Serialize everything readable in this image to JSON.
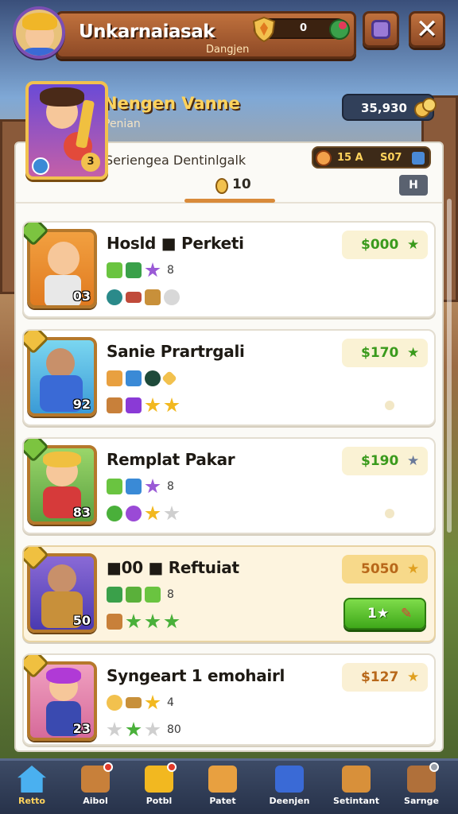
{
  "header": {
    "title": "Unkarnaiasak",
    "subtitle": "Dangjen",
    "resource_value": "0"
  },
  "hero": {
    "name": "Nengen Vanne",
    "role": "Penian",
    "coins": "35,930",
    "portrait_level": "3"
  },
  "panel": {
    "subtitle": "Seriengea Dentinlgalk",
    "stat_a": "15 A",
    "stat_b": "S07",
    "tab_count": "10",
    "tab_button": "H"
  },
  "cards": [
    {
      "name": "Hosld ■ Perketi",
      "price": "$000",
      "level": "03",
      "row1_text": "8",
      "highlighted": false
    },
    {
      "name": "Sanie Prartrgali",
      "price": "$170",
      "level": "92",
      "row1_text": "",
      "highlighted": false
    },
    {
      "name": "Remplat Pakar",
      "price": "$190",
      "level": "83",
      "row1_text": "8",
      "highlighted": false
    },
    {
      "name": "■00 ■ Reftuiat",
      "price": "5050",
      "level": "50",
      "row1_text": "8",
      "highlighted": true,
      "buy_label": "1★"
    },
    {
      "name": "Syngeart 1 emohairl",
      "price": "$127",
      "level": "23",
      "row1_text": "4",
      "row2_text": "80",
      "highlighted": false
    }
  ],
  "nav": [
    {
      "label": "Retto",
      "icon": "home-icon",
      "active": true
    },
    {
      "label": "Aibol",
      "icon": "bag-icon",
      "active": false
    },
    {
      "label": "Potbl",
      "icon": "chest-icon",
      "active": false
    },
    {
      "label": "Patet",
      "icon": "box-icon",
      "active": false
    },
    {
      "label": "Deenjen",
      "icon": "sword-icon",
      "active": false
    },
    {
      "label": "Setintant",
      "icon": "crate-icon",
      "active": false
    },
    {
      "label": "Sarnge",
      "icon": "shop-icon",
      "active": false
    }
  ],
  "colors": {
    "accent_gold": "#ffd35c",
    "price_green": "#3a9a1c",
    "wood": "#8e4a26",
    "buy_green": "#3fa81a"
  }
}
